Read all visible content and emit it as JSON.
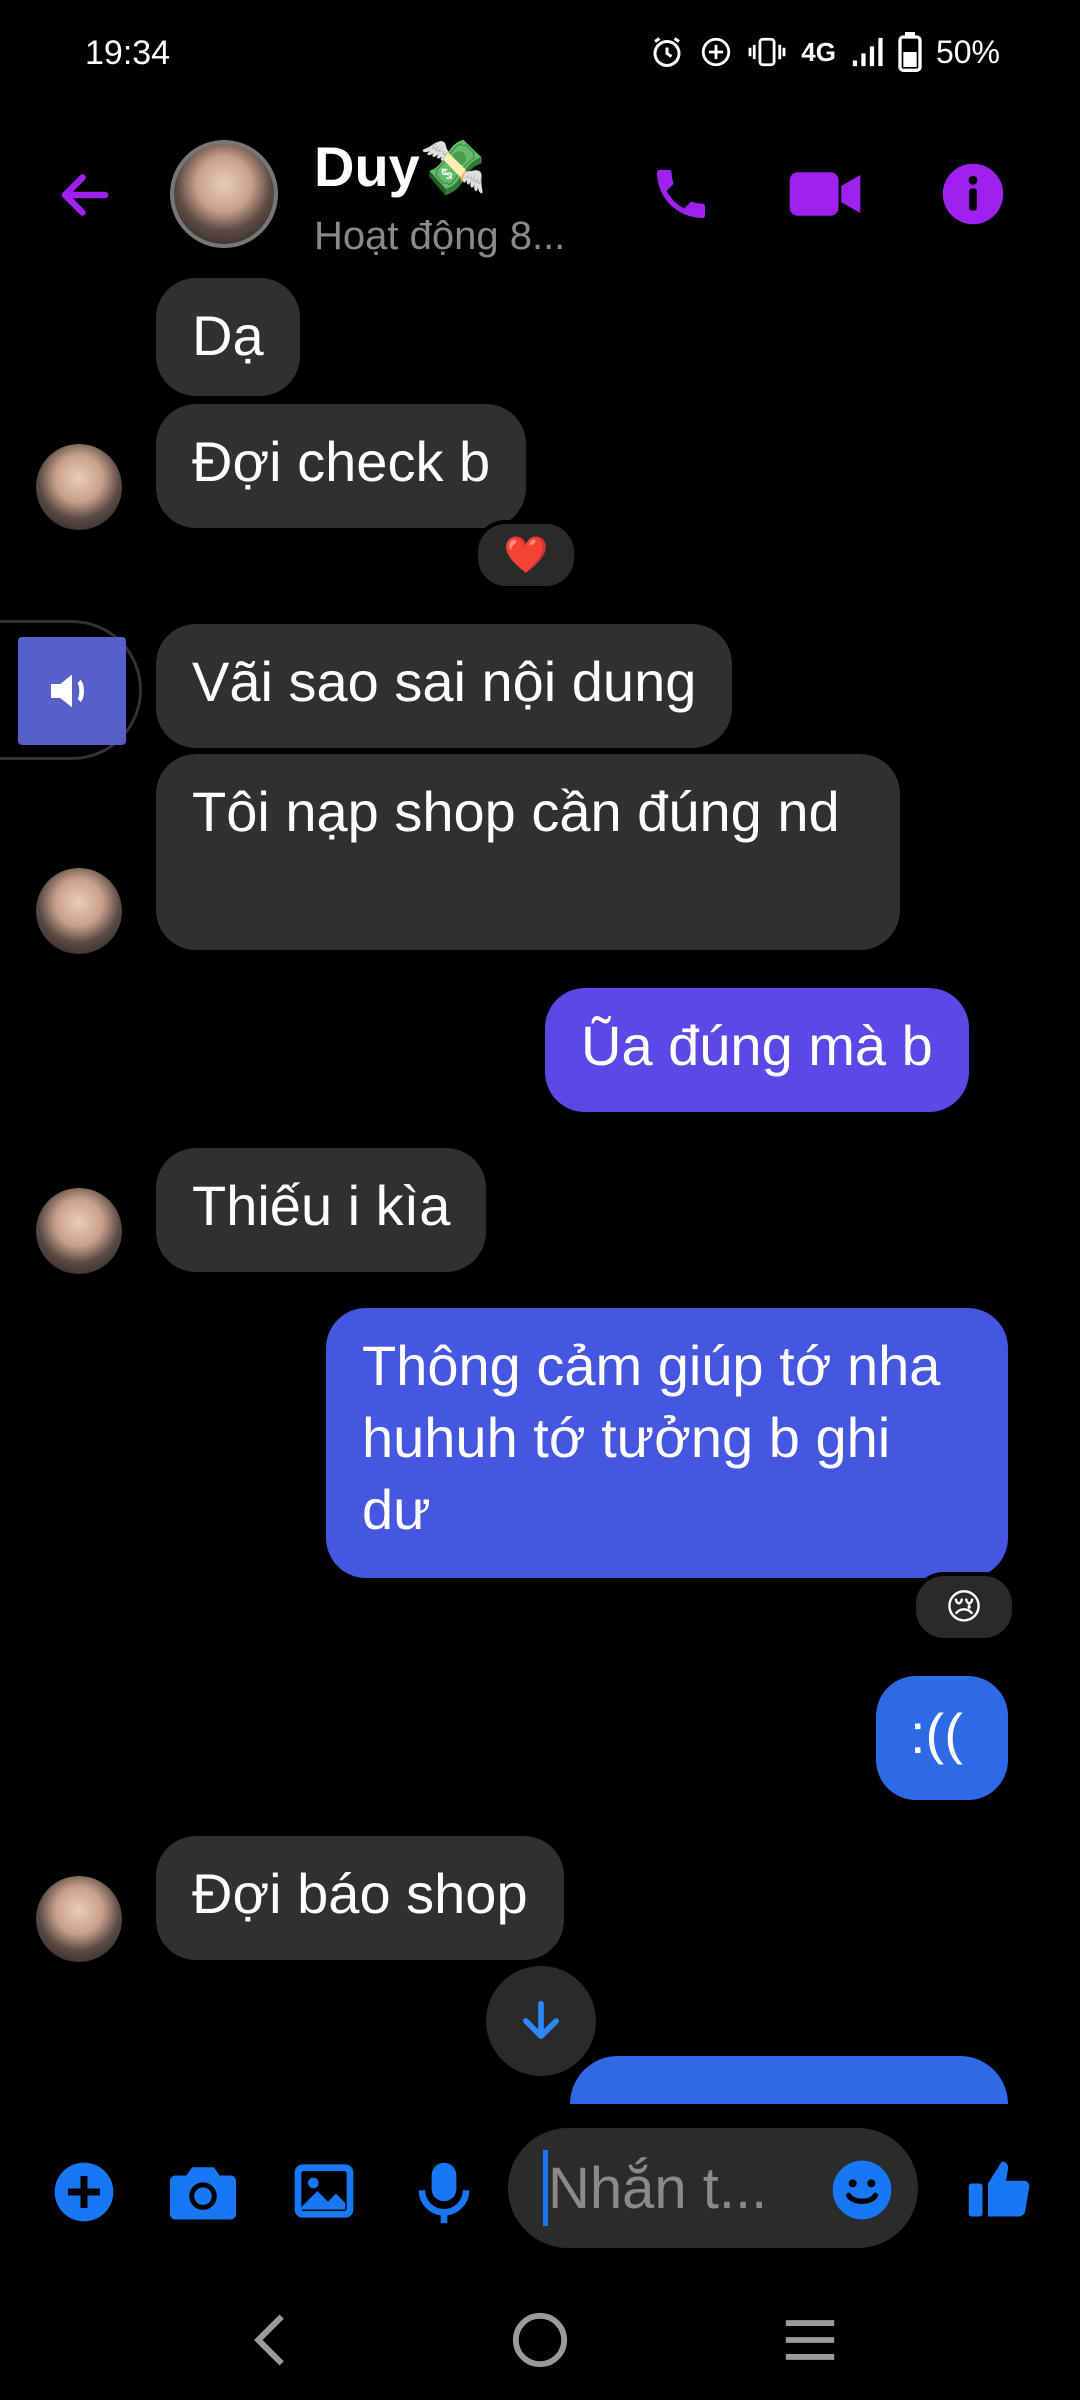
{
  "status_bar": {
    "time": "19:34",
    "network": "4G",
    "battery": "50%"
  },
  "header": {
    "name": "Duy",
    "name_emoji": "💸",
    "status": "Hoạt động 8..."
  },
  "messages": [
    {
      "text": "Dạ"
    },
    {
      "text": "Đợi check  b",
      "reaction": "❤️"
    },
    {
      "text": "Vãi sao sai nội dung"
    },
    {
      "text": "Tôi nạp shop cần đúng nd"
    },
    {
      "text": "Ũa đúng mà b"
    },
    {
      "text": "Thiếu i kìa"
    },
    {
      "text": "Thông cảm giúp tớ nha huhuh tớ tưởng b ghi dư",
      "reaction": "😢"
    },
    {
      "text": ":(("
    },
    {
      "text": "Đợi báo shop"
    }
  ],
  "composer": {
    "placeholder": "Nhắn t..."
  },
  "colors": {
    "accent": "#a020f0",
    "blue": "#1877f2",
    "bubble_incoming": "#303030"
  }
}
